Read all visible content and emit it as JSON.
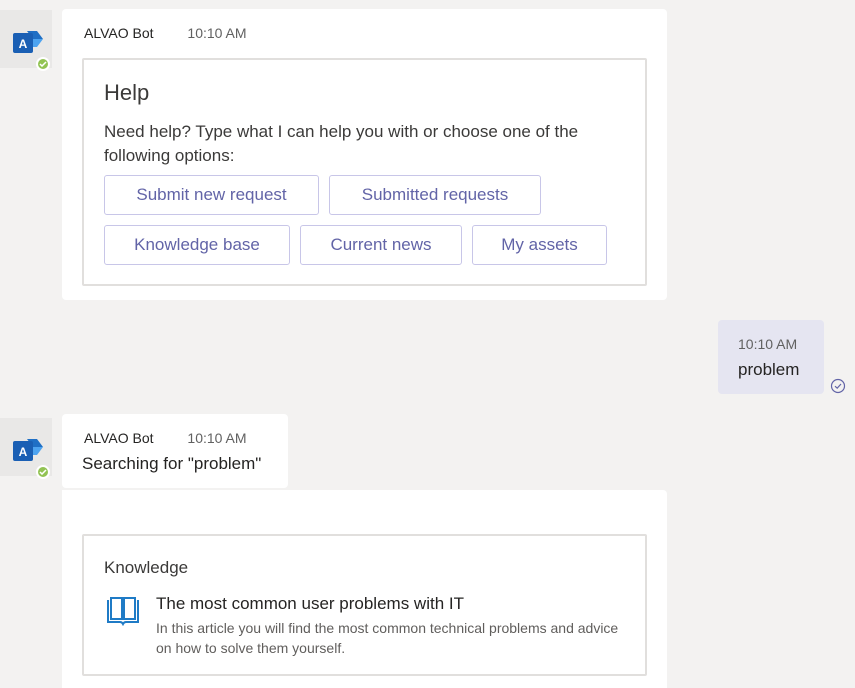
{
  "bot_name": "ALVAO Bot",
  "messages": {
    "help": {
      "time": "10:10 AM",
      "title": "Help",
      "text": "Need help? Type what I can help you with or choose one of the following options:",
      "buttons": [
        "Submit new request",
        "Submitted requests",
        "Knowledge base",
        "Current news",
        "My assets"
      ]
    },
    "user": {
      "time": "10:10 AM",
      "text": "problem"
    },
    "search": {
      "time": "10:10 AM",
      "text": "Searching for \"problem\""
    },
    "knowledge": {
      "section_title": "Knowledge",
      "article_title": "The most common user problems with IT",
      "article_desc": "In this article you will find the most common technical problems and advice on how to solve them yourself."
    }
  },
  "icons": {
    "bot_avatar": "alvao-logo-icon",
    "status": "available-check-icon",
    "read_receipt": "seen-check-icon",
    "article": "book-icon"
  },
  "colors": {
    "accent": "#6264a7",
    "status_green": "#92c353",
    "my_message_bg": "#e5e5f1"
  }
}
